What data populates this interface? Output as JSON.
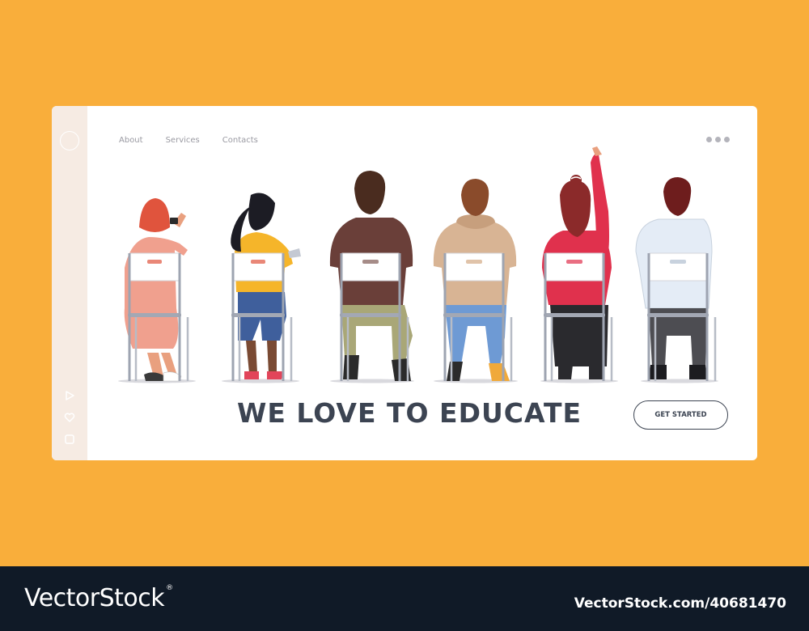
{
  "nav": {
    "items": [
      "About",
      "Services",
      "Contacts"
    ]
  },
  "headline": "WE LOVE TO EDUCATE",
  "cta_label": "GET STARTED",
  "sidebar_icons": [
    "play-icon",
    "heart-icon",
    "square-icon"
  ],
  "watermark": {
    "brand": "VectorStock",
    "mark": "®",
    "image_id": "VectorStock.com/40681470"
  },
  "colors": {
    "background": "#f9ae3b",
    "card": "#ffffff",
    "sidebar": "#f6ebe3",
    "text_dark": "#3c4452",
    "footer": "#101a27"
  }
}
